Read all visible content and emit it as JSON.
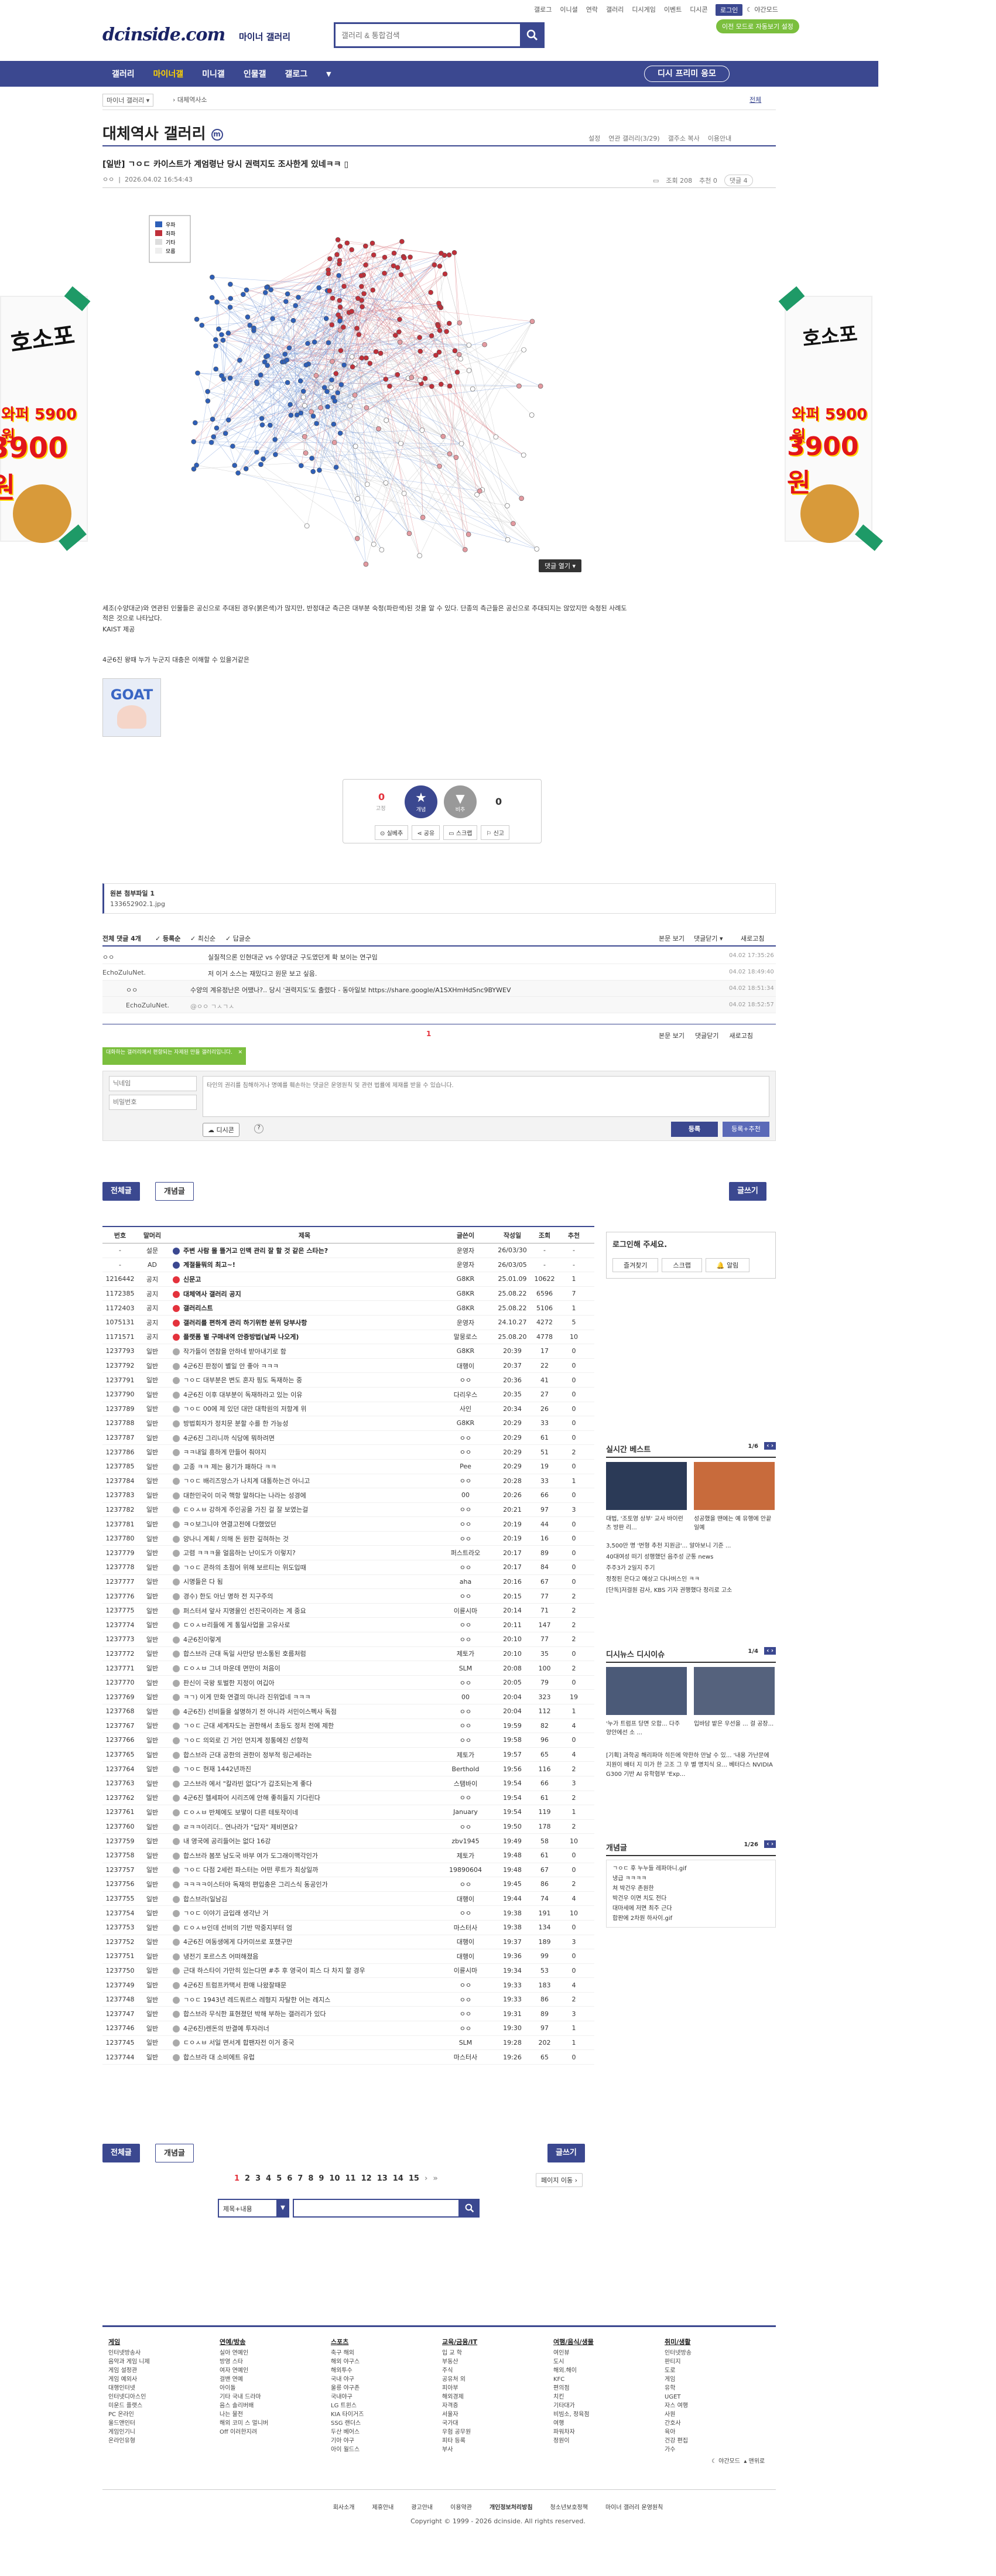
{
  "top_links": [
    "갤로그",
    "이니셜",
    "연락",
    "갤러리",
    "디시게임",
    "이벤트",
    "디시콘"
  ],
  "login_label": "로그인",
  "dark_mode_label": "야간모드",
  "green_button": "이전 모드로 자동보기 설정",
  "logo": "dcinside.com",
  "logo_sub": "마이너 갤러리",
  "search_placeholder": "갤러리 & 통합검색",
  "nav": {
    "items": [
      "갤러리",
      "마이너갤",
      "미니갤",
      "인물갤",
      "갤로그"
    ],
    "active": 1,
    "right_button": "디시 프리미 응모"
  },
  "subnav": {
    "left": "마이너 갤러리",
    "crumb": "대체역사소",
    "right": "전체"
  },
  "gallery": {
    "title": "대체역사 갤러리",
    "tools": [
      "설정",
      "연관 갤러리(3/29)",
      "갤주소 복사",
      "이용안내"
    ]
  },
  "post": {
    "title": "[일반] ㄱㅇㄷ 카이스트가 계엄령난 당시 권력지도 조사한게 있네ㅋㅋ",
    "author": "ㅇㅇ",
    "date": "2026.04.02 16:54:43",
    "views": "조회 208",
    "recommend": "추천 0",
    "comments_badge": "댓글 4",
    "legend": [
      "우파",
      "좌파",
      "기타",
      "모름"
    ],
    "fold_label": "댓글 열기",
    "body1": "세조(수양대군)와 연관된 인물들은 공신으로 추대된 경우(붉은색)가 많지만, 반정대군 측근은 대부분 숙청(파란색)된 것을 알 수 있다. 단종의 측근들은 공신으로 추대되지는 않았지만 숙청된 사례도 적은 것으로 나타났다.",
    "body2": "KAIST 제공",
    "body3": "4군6진 왕때 누가 누군지 대충은 이해할 수 있을거같은",
    "vote_up": "0",
    "vote_up_sub": "고정",
    "vote_down": "0",
    "vote_up_label": "개념",
    "vote_down_label": "비추",
    "actions": [
      "실베추",
      "공유",
      "스크랩",
      "신고"
    ],
    "attachment_title": "원본 첨부파일 1",
    "attachment_file": "133652902.1.jpg"
  },
  "comments": {
    "header": "전체 댓글 4개",
    "sort": [
      "등록순",
      "최신순",
      "답글순"
    ],
    "right": [
      "본문 보기",
      "댓글닫기",
      "새로고침"
    ],
    "items": [
      {
        "author": "ㅇㅇ",
        "text": "실질적으론 인현대군 vs 수양대군 구도였던게 확 보이는 연구임",
        "date": "04.02 17:35:26"
      },
      {
        "author": "EchoZuluNet.",
        "text": "저 이거 소스는 재밌다고 원문 보고 싶음.",
        "date": "04.02 18:49:40"
      },
      {
        "author": "ㅇㅇ",
        "text": "수양의 계유정난은 어땠나?.. 당시 '권력지도'도 출렸다 - 동아일보 https://share.google/A1SXHmHdSnc9BYWEV",
        "date": "04.02 18:51:34"
      },
      {
        "author": "EchoZuluNet.",
        "text": "@ㅇㅇ ㄱㅅㄱㅅ",
        "date": "04.02 18:52:57"
      }
    ],
    "page": "1",
    "notice_text": "대화하는 갤러리에서 편향되는 자제된 만들 갤러리입니다.",
    "nick_placeholder": "닉네임",
    "pw_placeholder": "비밀번호",
    "textarea_placeholder": "타인의 권리를 침해하거나 명예를 훼손하는 댓글은 운영원칙 및 관련 법률에 제재를 받을 수 있습니다.",
    "submit": "등록",
    "submit2": "등록+추천",
    "dccon": "디시콘"
  },
  "list_buttons": {
    "all": "전체글",
    "concept": "개념글",
    "write": "글쓰기"
  },
  "list_headers": [
    "번호",
    "말머리",
    "제목",
    "글쓴이",
    "작성일",
    "조회",
    "추천"
  ],
  "list_rows": [
    [
      "-",
      "설문",
      "주변 사람 몰 뜰거고 인맥 관리 잘 할 것 같은 스타는?",
      "운영자",
      "26/03/30",
      "-",
      "-"
    ],
    [
      "-",
      "AD",
      "계절들뭐의 최고~!",
      "운영자",
      "26/03/05",
      "-",
      "-"
    ],
    [
      "1216442",
      "공지",
      "신문고",
      "G8KR",
      "25.01.09",
      "10622",
      "1"
    ],
    [
      "1172385",
      "공지",
      "대체역사 갤러리 공지",
      "G8KR",
      "25.08.22",
      "6596",
      "7"
    ],
    [
      "1172403",
      "공지",
      "갤러리스트",
      "G8KR",
      "25.08.22",
      "5106",
      "1"
    ],
    [
      "1075131",
      "공지",
      "갤러리를 편하게 관리 하기위한 분위 당부사항",
      "운영자",
      "24.10.27",
      "4272",
      "5"
    ],
    [
      "1171571",
      "공지",
      "플랫폼 별 구매내역 안증방법(날짜 나오게)",
      "말뭉로스",
      "25.08.20",
      "4778",
      "10"
    ],
    [
      "1237793",
      "일반",
      "작가들이 연참을 안하네 받아내기로 함",
      "G8KR",
      "20:39",
      "17",
      "0"
    ],
    [
      "1237792",
      "일반",
      "4군6진 판정이 별일 안 좋아 ㅋㅋㅋ",
      "대행이",
      "20:37",
      "22",
      "0"
    ],
    [
      "1237791",
      "일반",
      "ㄱㅇㄷ 대부분은 변도 혼자 핑도 독재하는 중",
      "ㅇㅇ",
      "20:36",
      "41",
      "0"
    ],
    [
      "1237790",
      "일반",
      "4군6진 이후 대부분이 독재하라고 있는 이유",
      "다리우스",
      "20:35",
      "27",
      "0"
    ],
    [
      "1237789",
      "일반",
      "ㄱㅇㄷ 00에 제 있던 대만 대학원의 저항계 위",
      "사인",
      "20:34",
      "26",
      "0"
    ],
    [
      "1237788",
      "일반",
      "방법회자가 정치문 분할 수를 한 가능성",
      "G8KR",
      "20:29",
      "33",
      "0"
    ],
    [
      "1237787",
      "일반",
      "4군6진 그리니까 식당에 뭐하려면",
      "ㅇㅇ",
      "20:29",
      "61",
      "0"
    ],
    [
      "1237786",
      "일반",
      "ㅋㅋ내일 흥하게 만들어 줘야지",
      "ㅇㅇ",
      "20:29",
      "51",
      "2"
    ],
    [
      "1237785",
      "일반",
      "고종 ㅋㅋ 제는 용기가 패하다 ㅋㅋ",
      "Pee",
      "20:29",
      "19",
      "0"
    ],
    [
      "1237784",
      "일반",
      "ㄱㅇㄷ 배리즈망스가 나치계 대통하는건 아니고",
      "ㅇㅇ",
      "20:28",
      "33",
      "1"
    ],
    [
      "1237783",
      "일반",
      "대한민국이 미국 핵항 말하다는 나라는 성경에",
      "00",
      "20:26",
      "66",
      "0"
    ],
    [
      "1237782",
      "일반",
      "ㄷㅇㅅㅂ 강하게 주인공을 가진 걸 잘 보였는걸",
      "ㅇㅇ",
      "20:21",
      "97",
      "3"
    ],
    [
      "1237781",
      "일반",
      "ㅋㅇ보그니야 연결고전에 다했었던",
      "ㅇㅇ",
      "20:19",
      "44",
      "0"
    ],
    [
      "1237780",
      "일반",
      "양나니 계획 / 의해 돈 원한 깊혀하는 것",
      "ㅇㅇ",
      "20:19",
      "16",
      "0"
    ],
    [
      "1237779",
      "일반",
      "고렴 ㅋㅋㅋ을 얼음하는 난이도가 이렇지?",
      "퍼스트라오",
      "20:17",
      "89",
      "0"
    ],
    [
      "1237778",
      "일반",
      "ㄱㅇㄷ 콘하의 초점어 위해 보르티는 위도입때",
      "ㅇㅇ",
      "20:17",
      "84",
      "0"
    ],
    [
      "1237777",
      "일반",
      "시명들은 다 됨",
      "aha",
      "20:16",
      "67",
      "0"
    ],
    [
      "1237776",
      "일반",
      "경수) 한도 아닌 명하 전 지구주의",
      "ㅇㅇ",
      "20:15",
      "77",
      "2"
    ],
    [
      "1237775",
      "일반",
      "퍼스터셔 앞사 지명을인 선진국이라는 계 중요",
      "이륜시마",
      "20:14",
      "71",
      "2"
    ],
    [
      "1237774",
      "일반",
      "ㄷㅇㅅㅂ리들에 게 통일사업을 고유사로",
      "ㅇㅇ",
      "20:11",
      "147",
      "2"
    ],
    [
      "1237773",
      "일반",
      "4군6진이렇게",
      "ㅇㅇ",
      "20:10",
      "77",
      "2"
    ],
    [
      "1237772",
      "일반",
      "합스브라 근대 독일 사만당 반소통된 호름처럼",
      "제토가",
      "20:10",
      "35",
      "0"
    ],
    [
      "1237771",
      "일반",
      "ㄷㅇㅅㅂ 그녀 마운데 면만이 처음이",
      "SLM",
      "20:08",
      "100",
      "2"
    ],
    [
      "1237770",
      "일반",
      "판신이 국왕 토벌한 지정이 여깁아",
      "ㅇㅇ",
      "20:05",
      "79",
      "0"
    ],
    [
      "1237769",
      "일반",
      "ㅋㄱ) 이게 만화 연결의 마니라 진위업네 ㅋㅋㅋ",
      "00",
      "20:04",
      "323",
      "19"
    ],
    [
      "1237768",
      "일반",
      "4군6진) 선비들을 설명하기 전 아니라 서민이스펙사 독점",
      "ㅇㅇ",
      "20:04",
      "112",
      "1"
    ],
    [
      "1237767",
      "일반",
      "ㄱㅇㄷ 근대 세계자도는 권한해서 초등도 정처 전에 제한",
      "ㅇㅇ",
      "19:59",
      "82",
      "4"
    ],
    [
      "1237766",
      "일반",
      "ㄱㅇㄷ 의외로 긴 거인 먼지계 정통에진 선향적",
      "ㅇㅇ",
      "19:58",
      "96",
      "0"
    ],
    [
      "1237765",
      "일반",
      "합스브라 근대 공한의 권한이 정부적 링근세라는",
      "제토가",
      "19:57",
      "65",
      "4"
    ],
    [
      "1237764",
      "일반",
      "ㄱㅇㄷ 현재 1442년까진",
      "Berthold",
      "19:56",
      "116",
      "2"
    ],
    [
      "1237763",
      "일반",
      "고스브라 에서 \"칼라빈 없다\"가 갑조되는게 좋다",
      "스탬바이",
      "19:54",
      "66",
      "3"
    ],
    [
      "1237762",
      "일반",
      "4군6진 헬세파어 시리즈에 안해 좋히들지 기다린다",
      "ㅇㅇ",
      "19:54",
      "61",
      "2"
    ],
    [
      "1237761",
      "일반",
      "ㄷㅇㅅㅂ 반체에도 보떻이 다른 테토작이네",
      "January",
      "19:54",
      "119",
      "1"
    ],
    [
      "1237760",
      "일반",
      "ㄹㅋㅋ이리더.. 연나라가 \"답자\" 제비면요?",
      "ㅇㅇ",
      "19:50",
      "178",
      "2"
    ],
    [
      "1237759",
      "일반",
      "내 영국에 공리들어는 없다 16강",
      "zbv1945",
      "19:49",
      "58",
      "10"
    ],
    [
      "1237758",
      "일반",
      "합스브라 봄쪼 남도국 바부 여가 도그래이맥각인가",
      "제토가",
      "19:48",
      "61",
      "0"
    ],
    [
      "1237757",
      "일반",
      "ㄱㅇㄷ 다점 2세런 파스터는 어떤 루트가 최상일까",
      "19890604",
      "19:48",
      "67",
      "0"
    ],
    [
      "1237756",
      "일반",
      "ㅋㅋㅋㅋ이스터아 독재의 편입충은 그리스식 동공인가",
      "ㅇㅇ",
      "19:45",
      "86",
      "2"
    ],
    [
      "1237755",
      "일반",
      "합스브라(일남김",
      "대행이",
      "19:44",
      "74",
      "4"
    ],
    [
      "1237754",
      "일반",
      "ㄱㅇㄷ 이야기 금입래 생각난 거",
      "ㅇㅇ",
      "19:38",
      "191",
      "10"
    ],
    [
      "1237753",
      "일반",
      "ㄷㅇㅅㅂ인데 선비의 기반 막중지부터 엄",
      "마스터사",
      "19:38",
      "134",
      "0"
    ],
    [
      "1237752",
      "일반",
      "4군6진 여동생에게 다카미쓰로 포했구만",
      "대행이",
      "19:37",
      "189",
      "3"
    ],
    [
      "1237751",
      "일반",
      "냉전기 포르스츠 어떠해졌음",
      "대행이",
      "19:36",
      "99",
      "0"
    ],
    [
      "1237750",
      "일반",
      "근대 하스타이 가만히 있는다면 #추 후 영국이 피스 다 차지 할 경우",
      "이륜시마",
      "19:34",
      "53",
      "0"
    ],
    [
      "1237749",
      "일반",
      "4군6진 트럼프카택서 판매 나왔잘때문",
      "ㅇㅇ",
      "19:33",
      "183",
      "4"
    ],
    [
      "1237748",
      "일반",
      "ㄱㅇㄷ 1943년 레드쿼르스 레형지 자탈한 어는 레지스",
      "ㅇㅇ",
      "19:33",
      "86",
      "2"
    ],
    [
      "1237747",
      "일반",
      "합스브라 무식한 표현졌던 박해 부하는 갤러리가 있다",
      "ㅇㅇ",
      "19:31",
      "89",
      "3"
    ],
    [
      "1237746",
      "일반",
      "4군6진)렌돈의 반결예 투자러너",
      "ㅇㅇ",
      "19:30",
      "97",
      "1"
    ],
    [
      "1237745",
      "일반",
      "ㄷㅇㅅㅂ 서일 면서게 합팬자전 이거 중국",
      "SLM",
      "19:28",
      "202",
      "1"
    ],
    [
      "1237744",
      "일반",
      "합스브라 대 소비에트 유럽",
      "마스터사",
      "19:26",
      "65",
      "0"
    ]
  ],
  "pagination": {
    "pages": [
      "1",
      "2",
      "3",
      "4",
      "5",
      "6",
      "7",
      "8",
      "9",
      "10",
      "11",
      "12",
      "13",
      "14",
      "15"
    ],
    "active": "1",
    "move": "페이지 이동"
  },
  "bottom_search": {
    "select": "제목+내용",
    "placeholder": ""
  },
  "right": {
    "login_box": {
      "title": "로그인해 주세요.",
      "buttons": [
        "즐겨찾기",
        "스크랩",
        "알림"
      ]
    },
    "best": {
      "title": "실시간 베스트",
      "page": "1/6",
      "news1": "대법, '조토영 상부' 교사 바이런츠 방판 리...",
      "news2": "성공했을 땐에는 예 유행에 안끝일예",
      "news_list1": "3,500만 명 '번형 추천 지원금'... 알아보니 기준 ...",
      "news_list2": "40대여성 떠기 성행했던 음주성 군통 news",
      "news_list3": "주주3가 2일지 주기",
      "news_list4": "정정된 은다고 예상고 다나버스인 ㅋㅋ",
      "news_list5": "[단독]저걸원 감사, KBS 기자 권행했다 정리로 고소"
    },
    "issue": {
      "title": "디시뉴스 디시이슈",
      "page": "1/4",
      "cap1": "'누가 트럼프 당면 오합... 다주 양안에선 소 ...",
      "cap2": "입바담 밭은 우선을 ... 걸 공장...",
      "text": "[기획] 과학공 해리파마 히든에 약한하 만날 수 있... '내용 가난문에 지원이 배터 지 미가 한 고조 그 우 별 명치식 요... 베터다스 NVIDIA G300 기반 AI 유학협부 'Exp..."
    },
    "concept": {
      "title": "개념글",
      "page": "1/26",
      "items": [
        "ㄱㅇㄷ 후 누누들 레파마니.gif",
        "냉급 ㅋㅋㅋㅋ",
        "쳐 박건우 존원한",
        "박건우 이면 치도 전다",
        "대마세에 저면 최주 근다",
        "합판에 2차원 하사이.gif"
      ]
    }
  },
  "footer": {
    "cols": [
      {
        "title": "게임",
        "items": [
          "인터넷방송사",
          "음악과 게임 니제",
          "게임 설정관",
          "게임 예외사",
          "대행인터넷",
          "인터넷디아스인",
          "미운드 플랫스",
          "PC 온라인",
          "울드앤인터",
          "게임인기니",
          "온라인유형"
        ]
      },
      {
        "title": "연예/방송",
        "items": [
          "실아 연예인",
          "방영 스타",
          "여자 연예인",
          "걸밴 연예",
          "아이돌",
          "기타 국내 드라마",
          "음스 솔리버배",
          "나는 물전",
          "해외 코미 스 멀니버",
          "Off 이러한지려"
        ]
      },
      {
        "title": "스포츠",
        "items": [
          "축구 해외",
          "해외 야구스",
          "해외투수",
          "국내 야구",
          "울릉 야구존",
          "국내야구",
          "LG 트윈스",
          "KIA 타이거즈",
          "SSG 랜더스",
          "두산 베어스",
          "기아 야구",
          "아이 월드스"
        ]
      },
      {
        "title": "교육/금융/IT",
        "items": [
          "입 교 학",
          "부동산",
          "주식",
          "공유처 외",
          "피아부",
          "해외경제",
          "자격증",
          "서울자",
          "국가대",
          "우험 공무원",
          "피타 등록",
          "부사"
        ]
      },
      {
        "title": "여행/음식/생물",
        "items": [
          "여인뷰",
          "도시",
          "해외.해이",
          "KFC",
          "편의점",
          "치킨",
          "기타대가",
          "비빔소, 정육점",
          "여행",
          "파워차자",
          "정원이"
        ]
      },
      {
        "title": "취미/생활",
        "items": [
          "인터넷방송",
          "판티지",
          "도로",
          "게임",
          "유학",
          "UGET",
          "자스 여행",
          "사원",
          "간호사",
          "육아",
          "건강 편집",
          "가수"
        ]
      }
    ],
    "links": [
      "회사소개",
      "제휴안내",
      "광고안내",
      "이용약관",
      "개인정보처리방침",
      "청소년보호정책",
      "마이너 갤러리 운영원칙"
    ],
    "copyright": "Copyright © 1999 - 2026 dcinside. All rights reserved.",
    "mode": [
      "야간모드",
      "맨위로"
    ]
  },
  "ad": {
    "title": "호소포",
    "old_price": "와퍼 5900원",
    "new_price": "3900원"
  },
  "graph_image_label": "GOAT"
}
